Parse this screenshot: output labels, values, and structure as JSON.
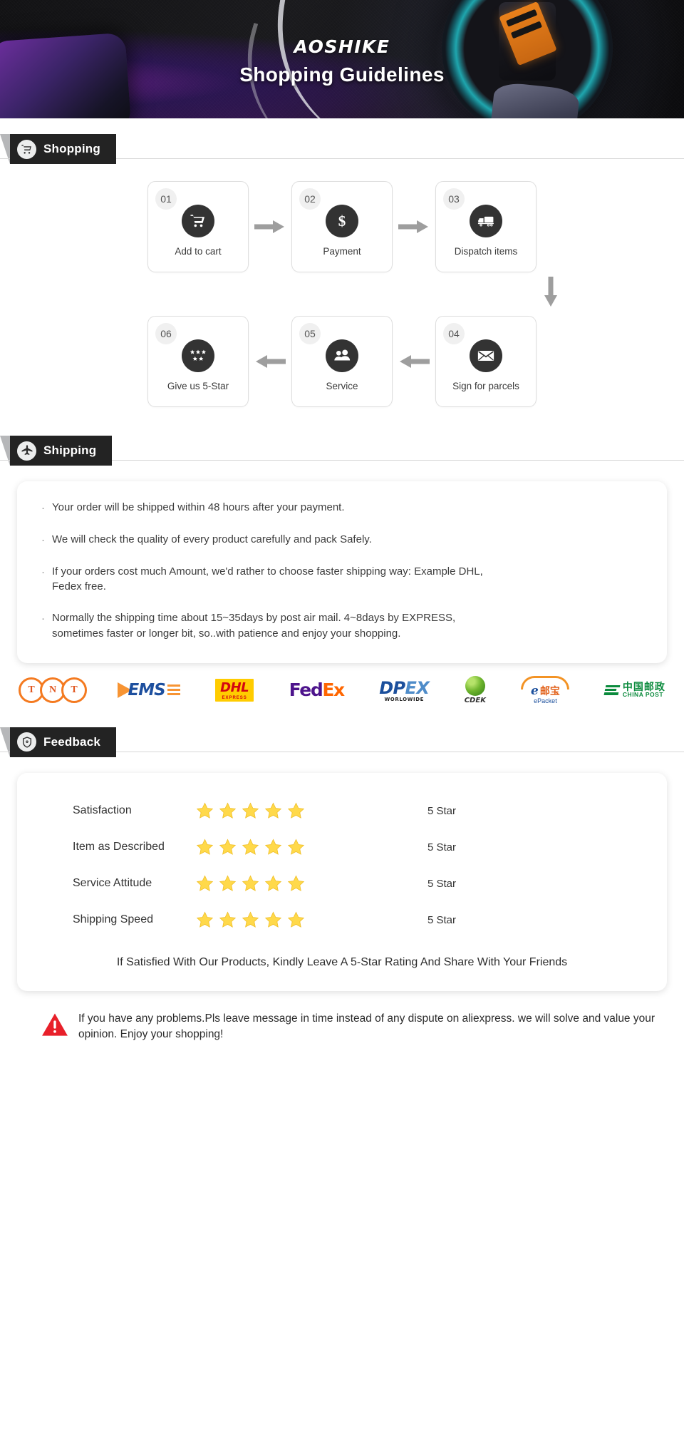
{
  "hero": {
    "brand": "AOSHIKE",
    "title": "Shopping Guidelines"
  },
  "sections": {
    "shopping": {
      "label": "Shopping",
      "icon": "shopping-cart-icon"
    },
    "shipping": {
      "label": "Shipping",
      "icon": "airplane-icon"
    },
    "feedback": {
      "label": "Feedback",
      "icon": "shield-icon"
    }
  },
  "steps": [
    {
      "num": "01",
      "label": "Add to cart",
      "icon": "cart-icon"
    },
    {
      "num": "02",
      "label": "Payment",
      "icon": "dollar-icon"
    },
    {
      "num": "03",
      "label": "Dispatch items",
      "icon": "truck-icon"
    },
    {
      "num": "04",
      "label": "Sign for parcels",
      "icon": "envelope-icon"
    },
    {
      "num": "05",
      "label": "Service",
      "icon": "people-icon"
    },
    {
      "num": "06",
      "label": "Give us 5-Star",
      "icon": "five-stars-icon"
    }
  ],
  "shipping_notes": [
    "Your order will be shipped within 48 hours after your payment.",
    "We will check the quality of every product carefully and pack Safely.",
    "If your orders cost much Amount, we'd rather to choose faster shipping way: Example DHL, Fedex free.",
    "Normally the shipping time about 15~35days by post air mail. 4~8days by EXPRESS, sometimes faster or longer bit, so..with patience and enjoy your shopping."
  ],
  "carriers": [
    {
      "name": "TNT",
      "letters": [
        "T",
        "N",
        "T"
      ]
    },
    {
      "name": "EMS",
      "text": "EMS"
    },
    {
      "name": "DHL",
      "text": "DHL",
      "sub": "EXPRESS"
    },
    {
      "name": "FedEx",
      "part1": "Fed",
      "part2": "Ex"
    },
    {
      "name": "DPEX",
      "part1": "DP",
      "part2": "EX",
      "sub": "WORLOWIDE"
    },
    {
      "name": "CDEK",
      "text": "CDEK"
    },
    {
      "name": "ePacket",
      "e": "e",
      "cn": "邮宝",
      "sub": "ePacket"
    },
    {
      "name": "China Post",
      "cn": "中国邮政",
      "sub": "CHINA  POST"
    }
  ],
  "feedback": {
    "rows": [
      {
        "name": "Satisfaction",
        "stars": 5,
        "value": "5 Star"
      },
      {
        "name": "Item as Described",
        "stars": 5,
        "value": "5 Star"
      },
      {
        "name": "Service Attitude",
        "stars": 5,
        "value": "5 Star"
      },
      {
        "name": "Shipping Speed",
        "stars": 5,
        "value": "5 Star"
      }
    ],
    "note": "If Satisfied With Our Products, Kindly Leave A 5-Star Rating And Share With Your Friends"
  },
  "footer": {
    "icon": "warning-triangle-icon",
    "text": "If you have any problems.Pls leave message in time instead of any dispute on aliexpress. we will solve and value your opinion. Enjoy your shopping!"
  },
  "colors": {
    "dark": "#232323",
    "icon_circle": "#333333",
    "arrow": "#9e9e9e",
    "star": "#ffd84d",
    "warning": "#e8202a"
  }
}
